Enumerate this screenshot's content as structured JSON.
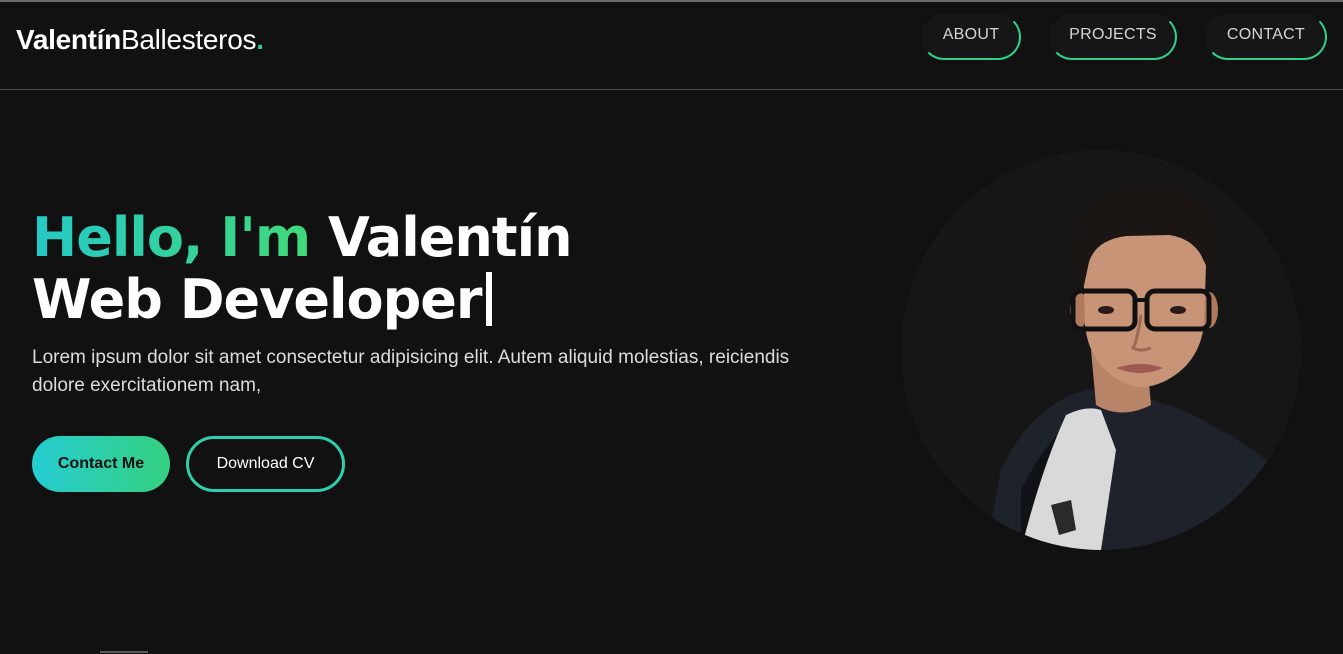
{
  "brand": {
    "first": "Valentín",
    "last": "Ballesteros",
    "dot": "."
  },
  "nav": {
    "about": "ABOUT",
    "projects": "PROJECTS",
    "contact": "CONTACT"
  },
  "hero": {
    "greeting": "Hello, I'm",
    "name": "Valentín",
    "role": "Web Developer",
    "description": "Lorem ipsum dolor sit amet consectetur adipisicing elit. Autem aliquid molestias, reiciendis dolore exercitationem nam,",
    "contact_button": "Contact Me",
    "cv_button": "Download CV"
  },
  "colors": {
    "background": "#111111",
    "accent_green": "#2fd18a",
    "accent_cyan": "#25c9c7"
  }
}
